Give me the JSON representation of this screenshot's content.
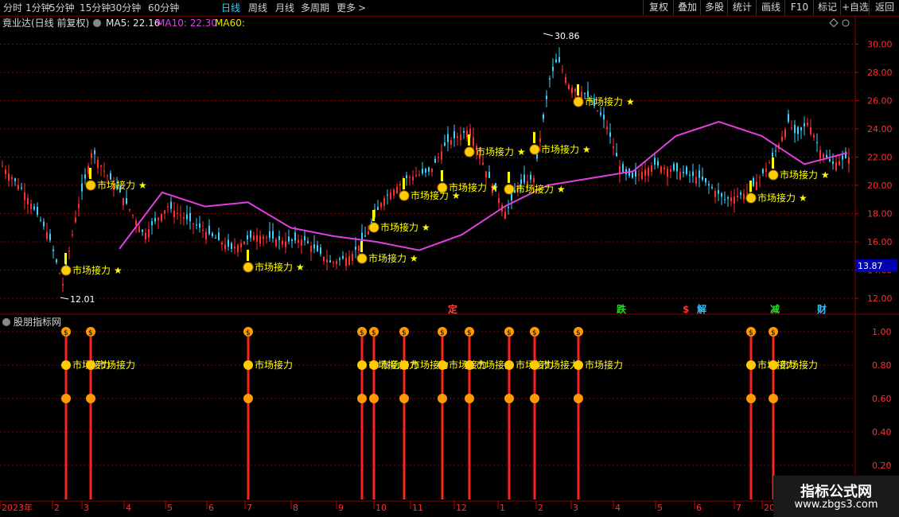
{
  "toolbar": {
    "periods": [
      "分时",
      "1分钟",
      "5分钟",
      "15分钟",
      "30分钟",
      "60分钟",
      "日线",
      "周线",
      "月线",
      "多周期",
      "更多"
    ],
    "active_period": "日线",
    "more_arrow": ">",
    "right_buttons": [
      "复权",
      "叠加",
      "多股",
      "统计",
      "画线",
      "F10",
      "标记",
      "+自选",
      "返回"
    ]
  },
  "chart_header": {
    "stock_title": "竟业达(日线 前复权)",
    "ma5_label": "MA5: 22.16",
    "ma10_label": "MA10: 22.30",
    "ma60_label": "MA60:",
    "ma5_color": "#e6e6e6",
    "ma10_color": "#e040e0",
    "ma60_color": "#e6e600"
  },
  "price_axis": {
    "ticks": [
      "30.00",
      "28.00",
      "26.00",
      "24.00",
      "22.00",
      "20.00",
      "18.00",
      "16.00",
      "14.00",
      "12.00"
    ],
    "current_price": "13.87",
    "high_label": "30.86",
    "low_label": "12.01"
  },
  "event_markers": [
    {
      "text": "定",
      "color": "#ff4040"
    },
    {
      "text": "跌",
      "color": "#20e020"
    },
    {
      "text": "$",
      "color": "#ff3030"
    },
    {
      "text": "解",
      "color": "#30c0ff"
    },
    {
      "text": "减",
      "color": "#20e020"
    },
    {
      "text": "财",
      "color": "#30c0ff"
    }
  ],
  "signal_label": "市场接力",
  "signal_star": "★",
  "indicator": {
    "title": "股朋指标网",
    "ticks": [
      "1.00",
      "0.80",
      "0.60",
      "0.40",
      "0.20"
    ]
  },
  "date_axis": {
    "labels": [
      "2023年",
      "2",
      "3",
      "4",
      "5",
      "6",
      "7",
      "8",
      "9",
      "10",
      "11",
      "12",
      "1",
      "2",
      "3",
      "4",
      "5",
      "6",
      "7",
      "20"
    ]
  },
  "watermark": {
    "line1": "指标公式网",
    "line2": "www.zbgs3.com"
  },
  "colors": {
    "up_candle": "#ff3030",
    "down_candle": "#40d0ff",
    "ma10_line": "#e040e0",
    "signal_yellow": "#ffff00",
    "grid_red": "#8a0000"
  },
  "chart_data": {
    "type": "line",
    "title": "竟业达(日线 前复权)",
    "ylim": [
      12,
      31
    ],
    "ma10_approx": {
      "x": [
        "2023-02",
        "2023-03",
        "2023-04",
        "2023-05",
        "2023-06",
        "2023-07",
        "2023-08",
        "2023-09",
        "2023-10",
        "2023-11",
        "2023-12",
        "2024-01",
        "2024-02",
        "2024-03",
        "2024-04",
        "2024-05",
        "2024-06",
        "2024-07"
      ],
      "values": [
        15.5,
        19.5,
        18.5,
        18.8,
        17.0,
        16.4,
        16.0,
        15.4,
        16.5,
        18.5,
        20.0,
        20.5,
        21.0,
        23.5,
        24.5,
        23.5,
        21.5,
        22.3
      ]
    },
    "signals_indicator_values": [
      1.0,
      0.8,
      0.6
    ]
  }
}
